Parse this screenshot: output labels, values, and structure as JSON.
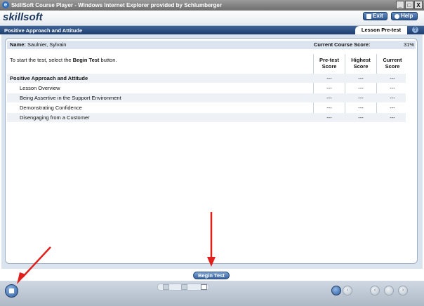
{
  "window": {
    "title": "SkillSoft Course Player - Windows Internet Explorer provided by Schlumberger",
    "ie_glyph": "e",
    "minimize": "_",
    "maximize": "□",
    "close": "X"
  },
  "header": {
    "logo": "skillsoft",
    "exit_label": "Exit",
    "help_label": "Help",
    "help_glyph": "?"
  },
  "course": {
    "title": "Positive Approach and Attitude",
    "tab_label": "Lesson Pre-test"
  },
  "student": {
    "name_label": "Name:",
    "name": "Saulnier, Sylvain",
    "score_label": "Current Course Score:",
    "score_value": "31%"
  },
  "instructions": {
    "prefix": "To start the test, select the ",
    "emph": "Begin Test",
    "suffix": " button."
  },
  "columns": [
    {
      "l1": "Pre-test",
      "l2": "Score"
    },
    {
      "l1": "Highest",
      "l2": "Score"
    },
    {
      "l1": "Current",
      "l2": "Score"
    }
  ],
  "rows": [
    {
      "label": "Positive Approach and Attitude",
      "pre": "---",
      "high": "---",
      "cur": "---"
    },
    {
      "label": "Lesson Overview",
      "pre": "---",
      "high": "---",
      "cur": "---"
    },
    {
      "label": "Being Assertive in the Support Environment",
      "pre": "---",
      "high": "---",
      "cur": "---"
    },
    {
      "label": "Demonstrating Confidence",
      "pre": "---",
      "high": "---",
      "cur": "---"
    },
    {
      "label": "Disengaging from a Customer",
      "pre": "---",
      "high": "---",
      "cur": "---"
    }
  ],
  "begin_button": "Begin Test",
  "nav_glyphs": {
    "prev": "‹",
    "next": "›"
  },
  "colors": {
    "title_bar": "#6e6e6e",
    "course_bar": "#2a4d82",
    "accent": "#3a64a0",
    "annotation_arrow": "#e0201a"
  }
}
